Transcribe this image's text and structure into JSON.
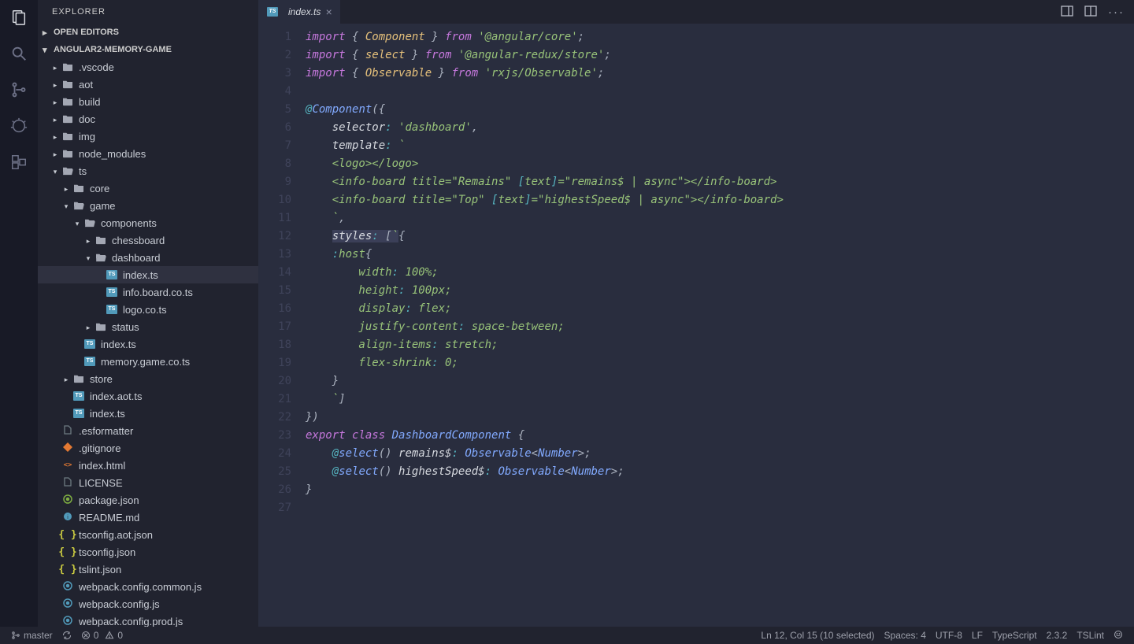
{
  "sidebar": {
    "title": "EXPLORER",
    "openEditors": "OPEN EDITORS",
    "projectName": "ANGULAR2-MEMORY-GAME"
  },
  "tree": [
    {
      "depth": 0,
      "type": "folder",
      "open": false,
      "name": ".vscode"
    },
    {
      "depth": 0,
      "type": "folder",
      "open": false,
      "name": "aot"
    },
    {
      "depth": 0,
      "type": "folder",
      "open": false,
      "name": "build"
    },
    {
      "depth": 0,
      "type": "folder",
      "open": false,
      "name": "doc"
    },
    {
      "depth": 0,
      "type": "folder",
      "open": false,
      "name": "img"
    },
    {
      "depth": 0,
      "type": "folder",
      "open": false,
      "name": "node_modules"
    },
    {
      "depth": 0,
      "type": "folder",
      "open": true,
      "name": "ts"
    },
    {
      "depth": 1,
      "type": "folder",
      "open": false,
      "name": "core"
    },
    {
      "depth": 1,
      "type": "folder",
      "open": true,
      "name": "game"
    },
    {
      "depth": 2,
      "type": "folder",
      "open": true,
      "name": "components"
    },
    {
      "depth": 3,
      "type": "folder",
      "open": false,
      "name": "chessboard"
    },
    {
      "depth": 3,
      "type": "folder",
      "open": true,
      "name": "dashboard"
    },
    {
      "depth": 4,
      "type": "file",
      "icon": "ts",
      "name": "index.ts",
      "selected": true
    },
    {
      "depth": 4,
      "type": "file",
      "icon": "ts",
      "name": "info.board.co.ts"
    },
    {
      "depth": 4,
      "type": "file",
      "icon": "ts",
      "name": "logo.co.ts"
    },
    {
      "depth": 3,
      "type": "folder",
      "open": false,
      "name": "status"
    },
    {
      "depth": 2,
      "type": "file",
      "icon": "ts",
      "name": "index.ts"
    },
    {
      "depth": 2,
      "type": "file",
      "icon": "ts",
      "name": "memory.game.co.ts"
    },
    {
      "depth": 1,
      "type": "folder",
      "open": false,
      "name": "store"
    },
    {
      "depth": 1,
      "type": "file",
      "icon": "ts",
      "name": "index.aot.ts"
    },
    {
      "depth": 1,
      "type": "file",
      "icon": "ts",
      "name": "index.ts"
    },
    {
      "depth": 0,
      "type": "file",
      "icon": "gray",
      "name": ".esformatter"
    },
    {
      "depth": 0,
      "type": "file",
      "icon": "git",
      "name": ".gitignore"
    },
    {
      "depth": 0,
      "type": "file",
      "icon": "html",
      "name": "index.html"
    },
    {
      "depth": 0,
      "type": "file",
      "icon": "gray",
      "name": "LICENSE"
    },
    {
      "depth": 0,
      "type": "file",
      "icon": "pkg",
      "name": "package.json"
    },
    {
      "depth": 0,
      "type": "file",
      "icon": "md",
      "name": "README.md"
    },
    {
      "depth": 0,
      "type": "file",
      "icon": "json",
      "name": "tsconfig.aot.json"
    },
    {
      "depth": 0,
      "type": "file",
      "icon": "json",
      "name": "tsconfig.json"
    },
    {
      "depth": 0,
      "type": "file",
      "icon": "json",
      "name": "tslint.json"
    },
    {
      "depth": 0,
      "type": "file",
      "icon": "blue",
      "name": "webpack.config.common.js"
    },
    {
      "depth": 0,
      "type": "file",
      "icon": "blue",
      "name": "webpack.config.js"
    },
    {
      "depth": 0,
      "type": "file",
      "icon": "blue",
      "name": "webpack.config.prod.js"
    }
  ],
  "tab": {
    "name": "index.ts"
  },
  "code": {
    "lines": 27,
    "content": [
      [
        {
          "c": "tok-kw",
          "t": "import"
        },
        {
          "c": "tok-punc",
          "t": " { "
        },
        {
          "c": "tok-type",
          "t": "Component"
        },
        {
          "c": "tok-punc",
          "t": " } "
        },
        {
          "c": "tok-kw",
          "t": "from"
        },
        {
          "c": "tok-punc",
          "t": " "
        },
        {
          "c": "tok-str",
          "t": "'@angular/core'"
        },
        {
          "c": "tok-punc",
          "t": ";"
        }
      ],
      [
        {
          "c": "tok-kw",
          "t": "import"
        },
        {
          "c": "tok-punc",
          "t": " { "
        },
        {
          "c": "tok-type",
          "t": "select"
        },
        {
          "c": "tok-punc",
          "t": " } "
        },
        {
          "c": "tok-kw",
          "t": "from"
        },
        {
          "c": "tok-punc",
          "t": " "
        },
        {
          "c": "tok-str",
          "t": "'@angular-redux/store'"
        },
        {
          "c": "tok-punc",
          "t": ";"
        }
      ],
      [
        {
          "c": "tok-kw",
          "t": "import"
        },
        {
          "c": "tok-punc",
          "t": " { "
        },
        {
          "c": "tok-type",
          "t": "Observable"
        },
        {
          "c": "tok-punc",
          "t": " } "
        },
        {
          "c": "tok-kw",
          "t": "from"
        },
        {
          "c": "tok-punc",
          "t": " "
        },
        {
          "c": "tok-str",
          "t": "'rxjs/Observable'"
        },
        {
          "c": "tok-punc",
          "t": ";"
        }
      ],
      [],
      [
        {
          "c": "tok-dec",
          "t": "@"
        },
        {
          "c": "tok-dec2",
          "t": "Component"
        },
        {
          "c": "tok-punc",
          "t": "({"
        }
      ],
      [
        {
          "c": "",
          "t": "    "
        },
        {
          "c": "tok-white",
          "t": "selector"
        },
        {
          "c": "tok-op",
          "t": ":"
        },
        {
          "c": "",
          "t": " "
        },
        {
          "c": "tok-str",
          "t": "'dashboard'"
        },
        {
          "c": "tok-punc",
          "t": ","
        }
      ],
      [
        {
          "c": "",
          "t": "    "
        },
        {
          "c": "tok-white",
          "t": "template"
        },
        {
          "c": "tok-op",
          "t": ":"
        },
        {
          "c": "",
          "t": " "
        },
        {
          "c": "tok-str",
          "t": "`"
        }
      ],
      [
        {
          "c": "tok-str",
          "t": "    <logo></logo>"
        }
      ],
      [
        {
          "c": "tok-str",
          "t": "    <info-board title=\"Remains\" "
        },
        {
          "c": "tok-op",
          "t": "["
        },
        {
          "c": "tok-str",
          "t": "text"
        },
        {
          "c": "tok-op",
          "t": "]"
        },
        {
          "c": "tok-str",
          "t": "=\"remains$ | async\"></info-board>"
        }
      ],
      [
        {
          "c": "tok-str",
          "t": "    <info-board title=\"Top\" "
        },
        {
          "c": "tok-op",
          "t": "["
        },
        {
          "c": "tok-str",
          "t": "text"
        },
        {
          "c": "tok-op",
          "t": "]"
        },
        {
          "c": "tok-str",
          "t": "=\"highestSpeed$ | async\"></info-board>"
        }
      ],
      [
        {
          "c": "tok-str",
          "t": "    `"
        },
        {
          "c": "tok-punc",
          "t": ","
        }
      ],
      [
        {
          "c": "",
          "t": "    "
        },
        {
          "c": "tok-white sel",
          "t": "styles"
        },
        {
          "c": "tok-op sel",
          "t": ":"
        },
        {
          "c": "sel",
          "t": " "
        },
        {
          "c": "tok-punc sel",
          "t": "["
        },
        {
          "c": "tok-str sel",
          "t": "`"
        },
        {
          "c": "tok-punc",
          "t": "{"
        }
      ],
      [
        {
          "c": "tok-str",
          "t": "    "
        },
        {
          "c": "tok-op",
          "t": ":"
        },
        {
          "c": "tok-str",
          "t": "host"
        },
        {
          "c": "tok-punc",
          "t": "{"
        }
      ],
      [
        {
          "c": "tok-str",
          "t": "        width"
        },
        {
          "c": "tok-op",
          "t": ":"
        },
        {
          "c": "tok-str",
          "t": " 100%;"
        }
      ],
      [
        {
          "c": "tok-str",
          "t": "        height"
        },
        {
          "c": "tok-op",
          "t": ":"
        },
        {
          "c": "tok-str",
          "t": " 100px;"
        }
      ],
      [
        {
          "c": "tok-str",
          "t": "        display"
        },
        {
          "c": "tok-op",
          "t": ":"
        },
        {
          "c": "tok-str",
          "t": " flex;"
        }
      ],
      [
        {
          "c": "tok-str",
          "t": "        justify-content"
        },
        {
          "c": "tok-op",
          "t": ":"
        },
        {
          "c": "tok-str",
          "t": " space-between;"
        }
      ],
      [
        {
          "c": "tok-str",
          "t": "        align-items"
        },
        {
          "c": "tok-op",
          "t": ":"
        },
        {
          "c": "tok-str",
          "t": " stretch;"
        }
      ],
      [
        {
          "c": "tok-str",
          "t": "        flex-shrink"
        },
        {
          "c": "tok-op",
          "t": ":"
        },
        {
          "c": "tok-str",
          "t": " 0;"
        }
      ],
      [
        {
          "c": "tok-str",
          "t": "    "
        },
        {
          "c": "tok-punc",
          "t": "}"
        }
      ],
      [
        {
          "c": "tok-str",
          "t": "    `"
        },
        {
          "c": "tok-punc",
          "t": "]"
        }
      ],
      [
        {
          "c": "tok-punc",
          "t": "})"
        }
      ],
      [
        {
          "c": "tok-kw",
          "t": "export"
        },
        {
          "c": "",
          "t": " "
        },
        {
          "c": "tok-kw",
          "t": "class"
        },
        {
          "c": "",
          "t": " "
        },
        {
          "c": "tok-dec2",
          "t": "DashboardComponent"
        },
        {
          "c": "",
          "t": " "
        },
        {
          "c": "tok-punc",
          "t": "{"
        }
      ],
      [
        {
          "c": "",
          "t": "    "
        },
        {
          "c": "tok-dec",
          "t": "@"
        },
        {
          "c": "tok-dec2",
          "t": "select"
        },
        {
          "c": "tok-punc",
          "t": "() "
        },
        {
          "c": "tok-white",
          "t": "remains$"
        },
        {
          "c": "tok-op",
          "t": ":"
        },
        {
          "c": "",
          "t": " "
        },
        {
          "c": "tok-dec2",
          "t": "Observable"
        },
        {
          "c": "tok-punc",
          "t": "<"
        },
        {
          "c": "tok-dec2",
          "t": "Number"
        },
        {
          "c": "tok-punc",
          "t": ">;"
        }
      ],
      [
        {
          "c": "",
          "t": "    "
        },
        {
          "c": "tok-dec",
          "t": "@"
        },
        {
          "c": "tok-dec2",
          "t": "select"
        },
        {
          "c": "tok-punc",
          "t": "() "
        },
        {
          "c": "tok-white",
          "t": "highestSpeed$"
        },
        {
          "c": "tok-op",
          "t": ":"
        },
        {
          "c": "",
          "t": " "
        },
        {
          "c": "tok-dec2",
          "t": "Observable"
        },
        {
          "c": "tok-punc",
          "t": "<"
        },
        {
          "c": "tok-dec2",
          "t": "Number"
        },
        {
          "c": "tok-punc",
          "t": ">;"
        }
      ],
      [
        {
          "c": "tok-punc",
          "t": "}"
        }
      ],
      []
    ]
  },
  "status": {
    "branch": "master",
    "errors": "0",
    "warnings": "0",
    "cursor": "Ln 12, Col 15 (10 selected)",
    "spaces": "Spaces: 4",
    "encoding": "UTF-8",
    "eol": "LF",
    "lang": "TypeScript",
    "version": "2.3.2",
    "lint": "TSLint"
  }
}
